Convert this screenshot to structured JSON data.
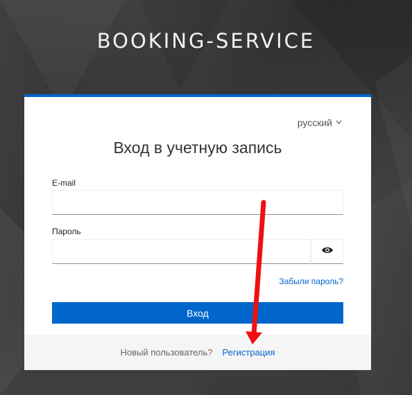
{
  "brand": {
    "title": "BOOKING-SERVICE"
  },
  "login": {
    "language": "русский",
    "title": "Вход в учетную запись",
    "email_label": "E-mail",
    "email_value": "",
    "password_label": "Пароль",
    "password_value": "",
    "forgot_link": "Забыли пароль?",
    "submit_label": "Вход",
    "new_user_text": "Новый пользователь?",
    "register_link": "Регистрация"
  },
  "colors": {
    "accent": "#0066cc",
    "annotation_arrow": "#ee1111"
  },
  "icons": {
    "language_toggle": "chevron-down-icon",
    "password_toggle": "eye-icon"
  }
}
